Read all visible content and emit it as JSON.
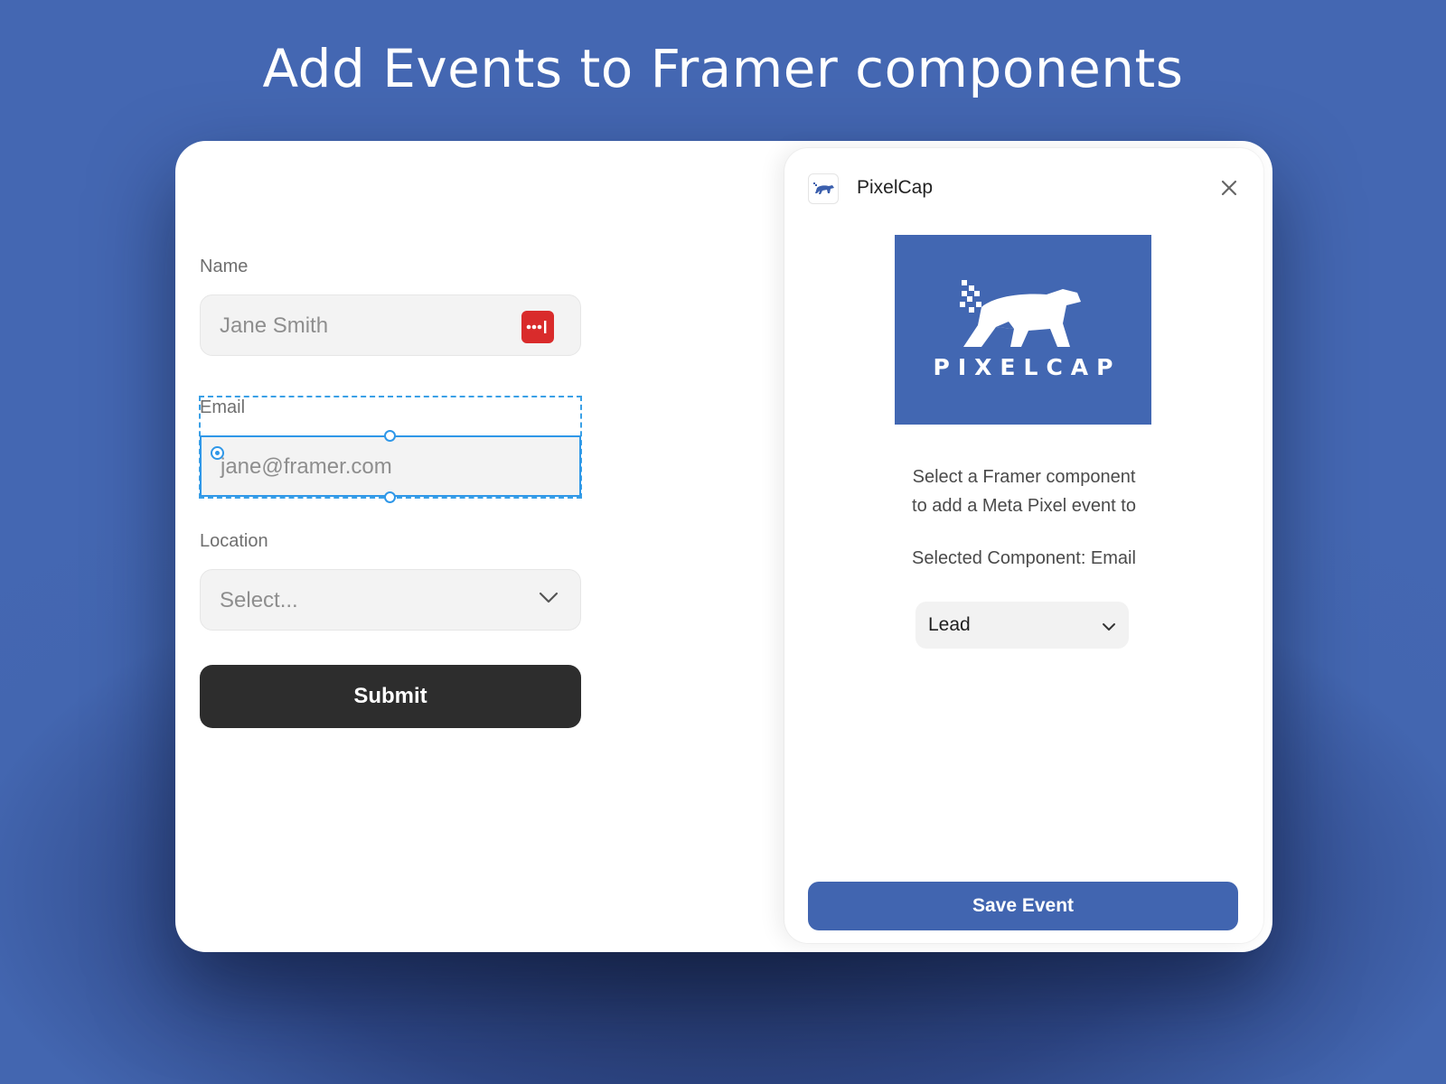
{
  "headline": "Add Events to Framer components",
  "form": {
    "name_label": "Name",
    "name_value": "Jane Smith",
    "email_label": "Email",
    "email_value": "jane@framer.com",
    "location_label": "Location",
    "location_value": "Select...",
    "submit_label": "Submit"
  },
  "panel": {
    "app_name": "PixelCap",
    "logo_text": "PIXELCAP",
    "description_line1": "Select a Framer component",
    "description_line2": "to add a Meta Pixel event to",
    "selected_component": "Selected Component: Email",
    "event_value": "Lead",
    "save_label": "Save Event"
  },
  "icons": {
    "password_manager": "password-manager-icon",
    "dropdown": "chevron-down-icon",
    "close": "close-icon",
    "app": "polar-bear-icon"
  },
  "colors": {
    "background": "#4467b2",
    "brand": "#4267b2",
    "selection": "#2f97e8",
    "submit": "#2d2d2d",
    "password_icon": "#d92b2b"
  }
}
